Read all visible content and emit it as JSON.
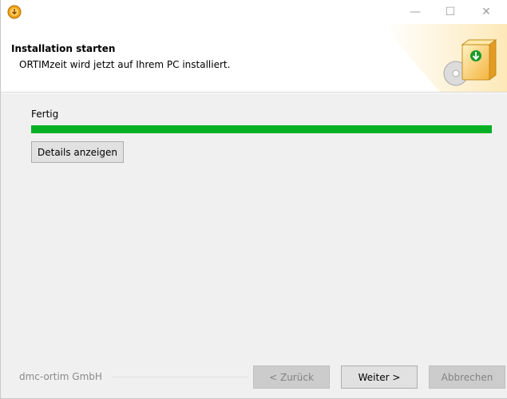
{
  "window": {
    "minimize_glyph": "—",
    "maximize_glyph": "☐",
    "close_glyph": "✕"
  },
  "header": {
    "title": "Installation starten",
    "subtitle": "ORTIMzeit wird jetzt auf Ihrem PC installiert."
  },
  "content": {
    "status": "Fertig",
    "progress_percent": 100,
    "details_label": "Details anzeigen"
  },
  "footer": {
    "brand": "dmc-ortim GmbH",
    "back_label": "< Zurück",
    "next_label": "Weiter >",
    "cancel_label": "Abbrechen"
  },
  "colors": {
    "progress_fill": "#06b025",
    "header_bg": "#ffffff",
    "dialog_bg": "#f0f0f0"
  },
  "icons": {
    "app": "installer-icon",
    "header": "box-cd-icon"
  }
}
